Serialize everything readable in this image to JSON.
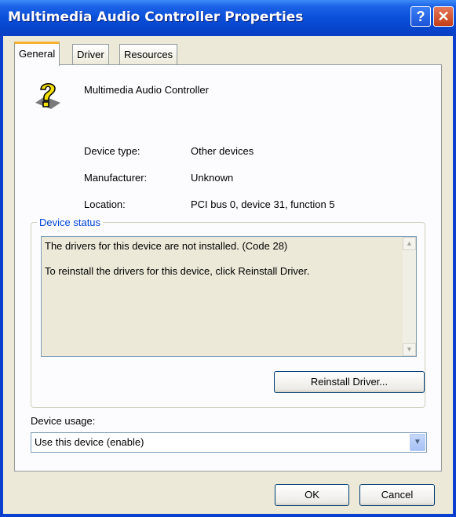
{
  "window": {
    "title": "Multimedia Audio Controller Properties",
    "help_label": "?",
    "close_label": "✕"
  },
  "tabs": [
    {
      "label": "General",
      "active": true
    },
    {
      "label": "Driver",
      "active": false
    },
    {
      "label": "Resources",
      "active": false
    }
  ],
  "device": {
    "name": "Multimedia Audio Controller",
    "icon": "unknown-device-question-icon",
    "properties": [
      {
        "label": "Device type:",
        "value": "Other devices"
      },
      {
        "label": "Manufacturer:",
        "value": "Unknown"
      },
      {
        "label": "Location:",
        "value": "PCI bus 0, device 31, function 5"
      }
    ]
  },
  "status": {
    "group_title": "Device status",
    "lines": [
      "The drivers for this device are not installed. (Code 28)",
      "To reinstall the drivers for this device, click Reinstall Driver."
    ],
    "reinstall_label": "Reinstall Driver..."
  },
  "usage": {
    "label": "Device usage:",
    "selected": "Use this device (enable)"
  },
  "buttons": {
    "ok": "OK",
    "cancel": "Cancel"
  },
  "colors": {
    "titlebar": "#0a4fd8",
    "group_title": "#0046d5",
    "tab_accent": "#f8b232"
  }
}
